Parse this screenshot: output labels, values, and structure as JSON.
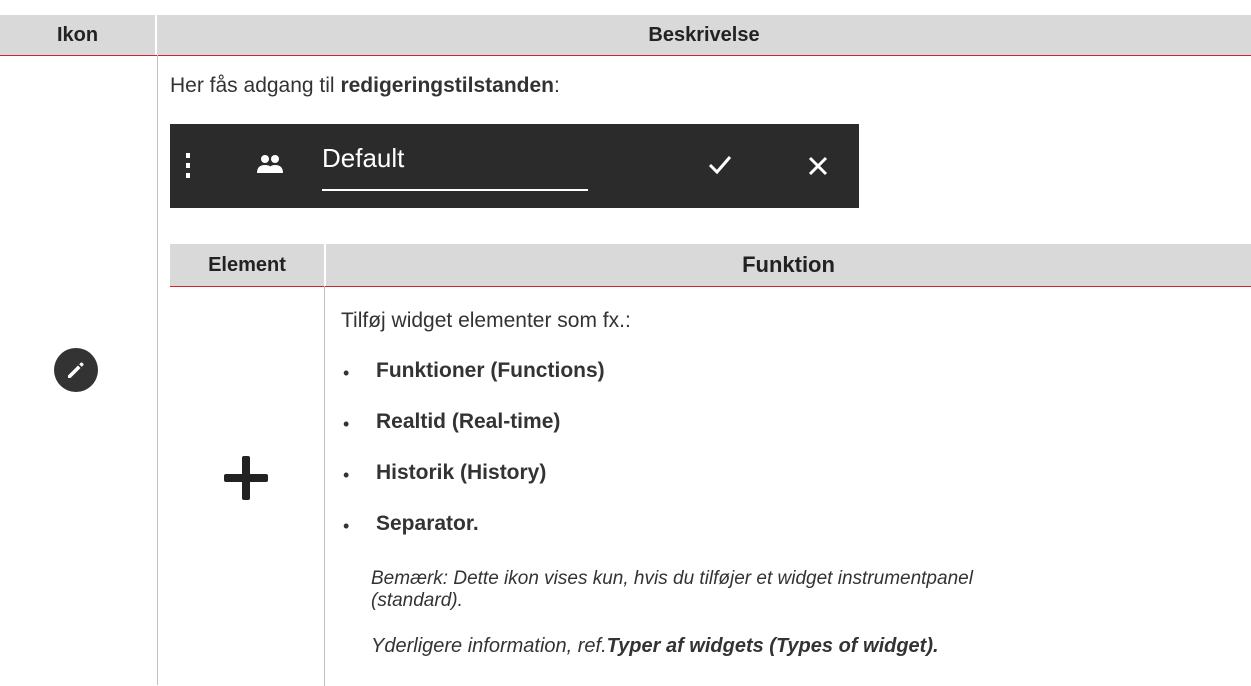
{
  "table": {
    "col_icon_header": "Ikon",
    "col_desc_header": "Beskrivelse"
  },
  "row": {
    "icon": "pencil-icon",
    "intro_prefix": "Her fås adgang til ",
    "intro_bold": "redigeringstilstanden",
    "intro_suffix": ":",
    "edit_bar": {
      "menu_icon": "kebab-menu-icon",
      "group_icon": "users-icon",
      "name_value": "Default",
      "confirm_icon": "check-icon",
      "cancel_icon": "close-icon"
    },
    "inner_table": {
      "col_element_header": "Element",
      "col_function_header": "Funktion",
      "element_icon": "plus-icon",
      "function_intro": "Tilføj widget elementer som fx.:",
      "bullets": [
        "Funktioner (Functions)",
        "Realtid (Real-time)",
        "Historik (History)",
        "Separator."
      ],
      "note_line1": "Bemærk: Dette ikon vises kun, hvis du tilføjer et widget instrumentpanel",
      "note_line2": "(standard).",
      "more_prefix": "Yderligere information, ref.",
      "more_link": "Typer af widgets (Types of widget)."
    }
  },
  "colors": {
    "header_bg": "#d9d9d9",
    "header_rule": "#d2222d",
    "bar_bg": "#2b2b2b"
  }
}
